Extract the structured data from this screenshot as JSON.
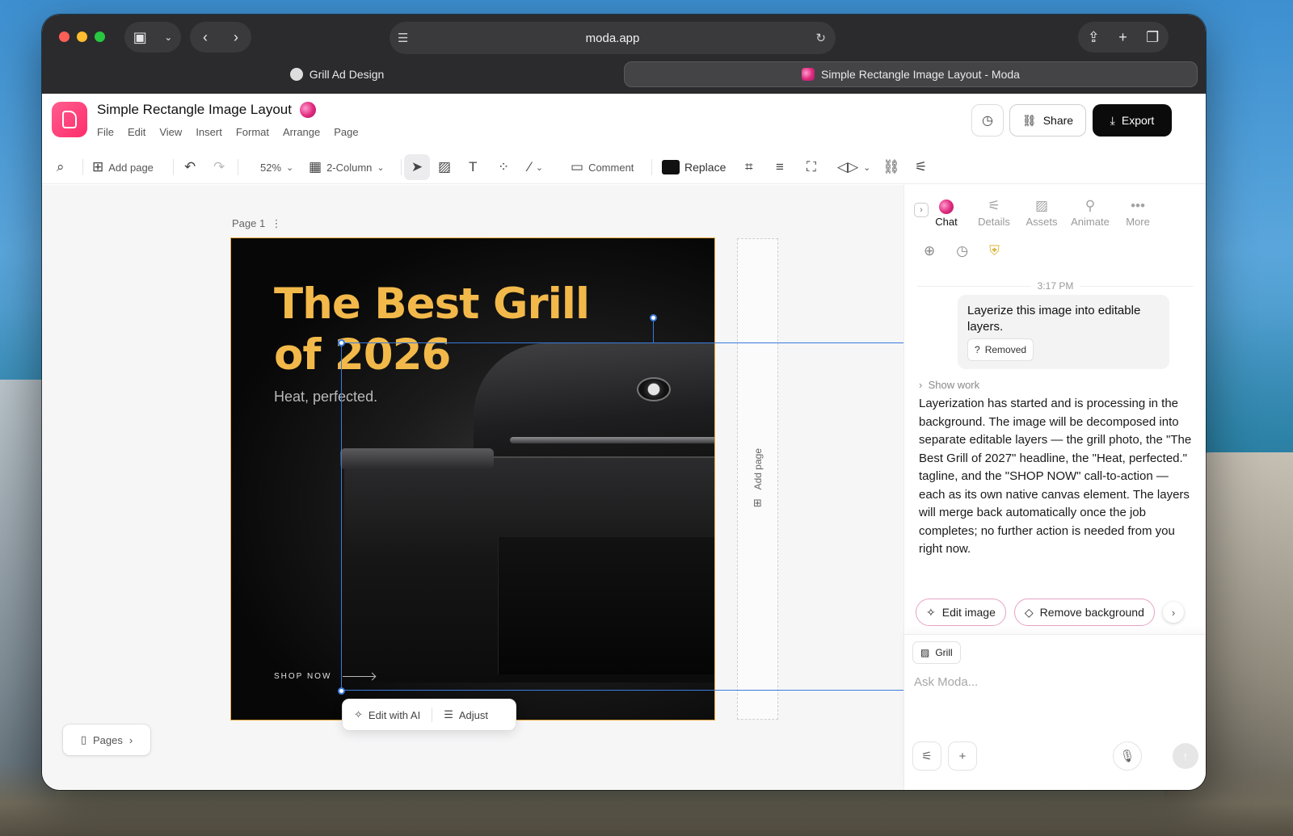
{
  "browser": {
    "address": "moda.app",
    "tabs": [
      {
        "title": "Grill Ad Design",
        "icon": "chatgpt-icon",
        "active": false
      },
      {
        "title": "Simple Rectangle Image Layout - Moda",
        "icon": "moda-icon",
        "active": true
      }
    ]
  },
  "app": {
    "doc_title": "Simple Rectangle Image Layout",
    "menus": [
      "File",
      "Edit",
      "View",
      "Insert",
      "Format",
      "Arrange",
      "Page"
    ],
    "share_label": "Share",
    "export_label": "Export"
  },
  "toolbar": {
    "add_page": "Add page",
    "zoom": "52%",
    "layout": "2-Column",
    "comment": "Comment",
    "replace": "Replace"
  },
  "canvas": {
    "page_label": "Page 1",
    "headline": "The Best Grill of 2026",
    "tagline": "Heat, perfected.",
    "cta": "SHOP NOW",
    "add_page_strip": "Add page",
    "edit_with_ai": "Edit with AI",
    "adjust": "Adjust",
    "pages_button": "Pages",
    "colors": {
      "headline": "#f2b94a",
      "selection": "#3a7bde",
      "artboard_outline": "#e8a93b"
    }
  },
  "panel": {
    "tabs": [
      "Chat",
      "Details",
      "Assets",
      "Animate",
      "More"
    ],
    "active_tab": "Chat",
    "timestamp": "3:17 PM",
    "user_message": "Layerize this image into editable layers.",
    "user_badge": "Removed",
    "show_work": "Show work",
    "reply": "Layerization has started and is processing in the background. The image will be decomposed into separate editable layers — the grill photo, the \"The Best Grill of 2027\" headline, the \"Heat, perfected.\" tagline, and the \"SHOP NOW\" call-to-action — each as its own native canvas element. The layers will merge back automatically once the job completes; no further action is needed from you right now.",
    "chips": [
      "Edit image",
      "Remove background"
    ],
    "context_chip": "Grill",
    "input_placeholder": "Ask Moda..."
  }
}
